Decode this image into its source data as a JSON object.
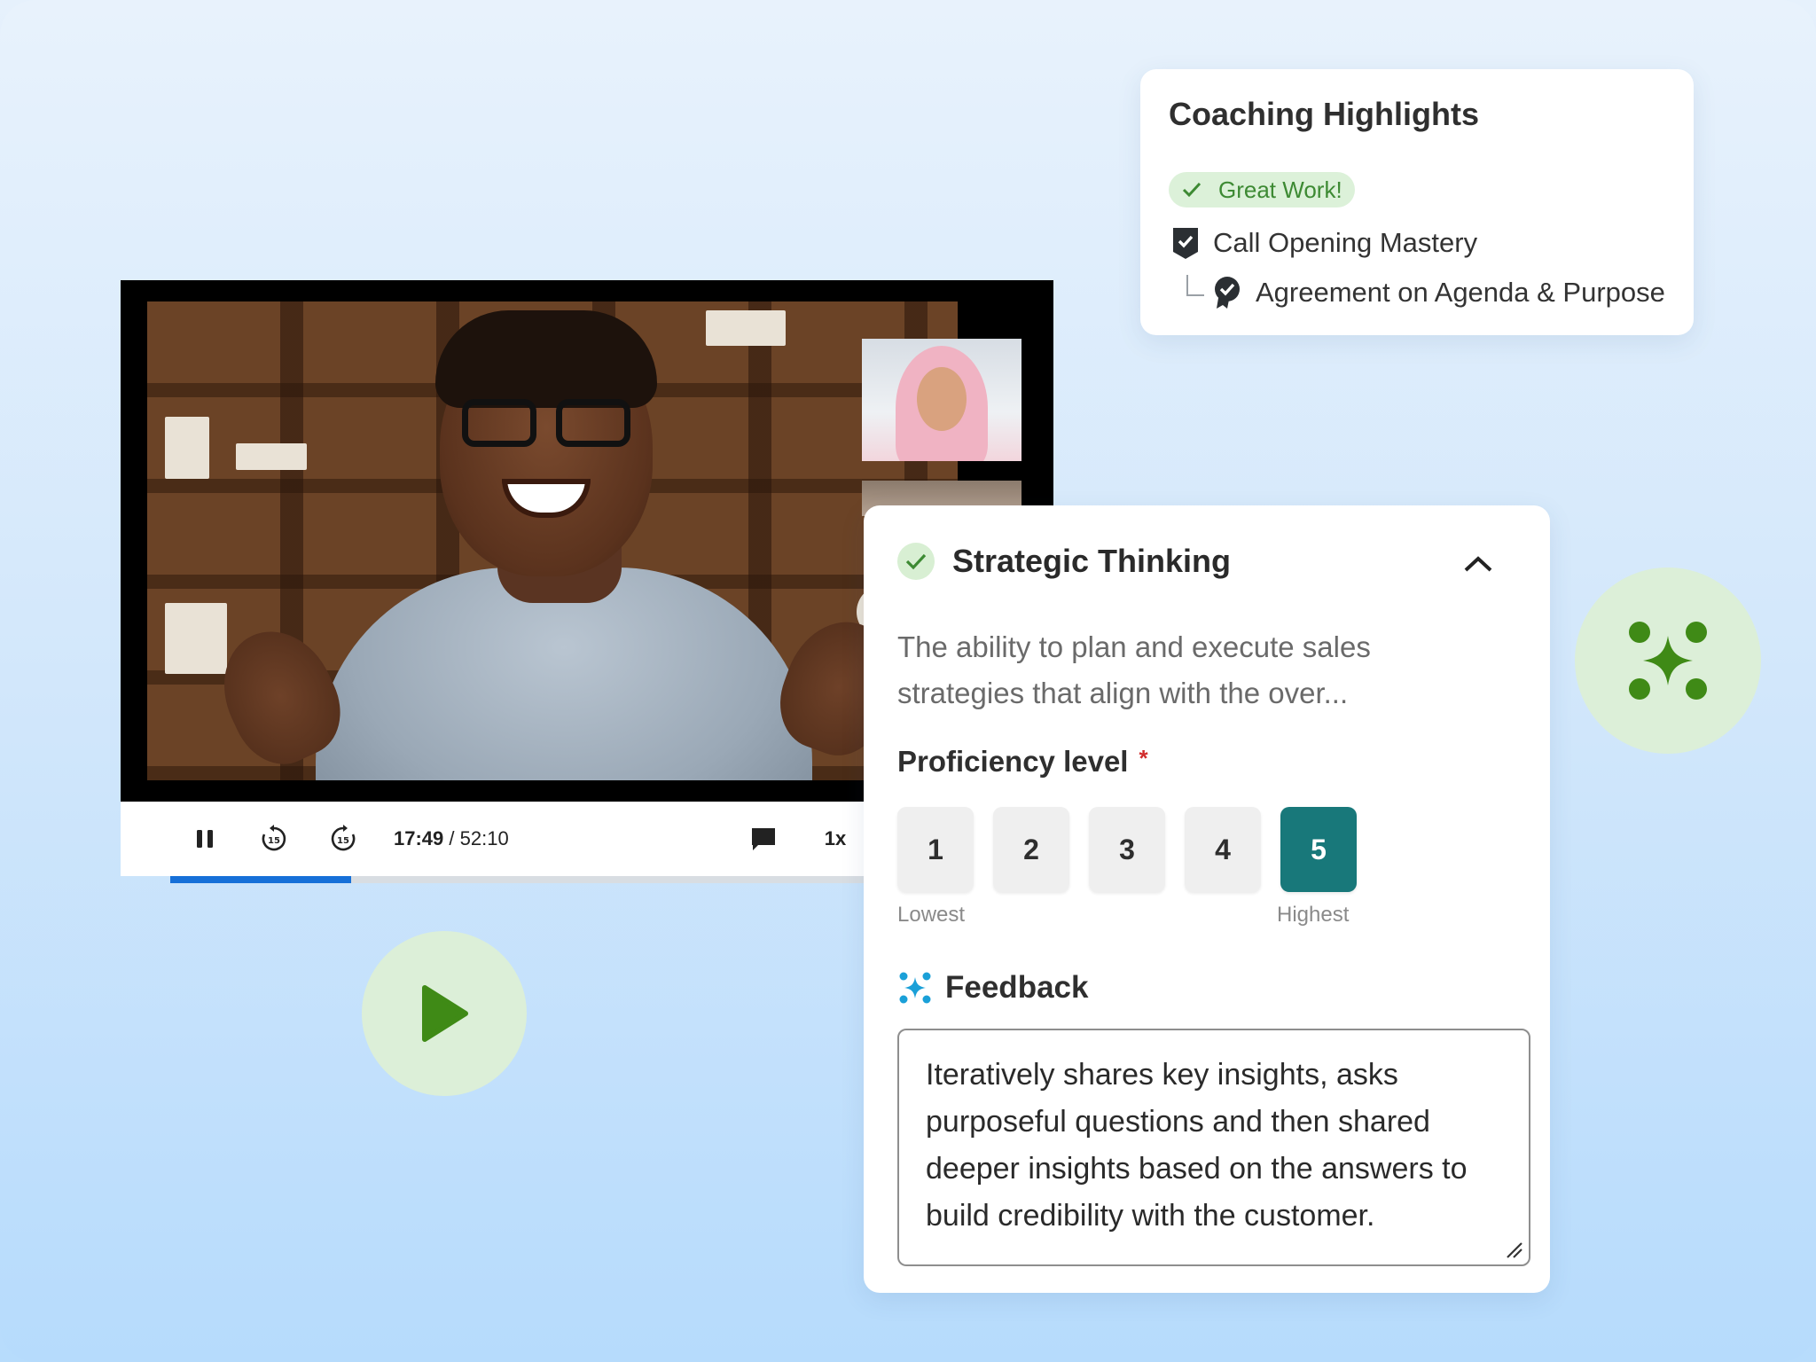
{
  "player": {
    "time_current": "17:49",
    "time_separator": " / ",
    "time_total": "52:10",
    "speed": "1x",
    "progress": 0.205,
    "icons": [
      "pause-icon",
      "rewind-15-icon",
      "forward-15-icon",
      "chat-icon"
    ]
  },
  "highlights": {
    "title": "Coaching Highlights",
    "badge": "Great Work!",
    "item": "Call Opening Mastery",
    "subitem": "Agreement on Agenda & Purpose"
  },
  "panel": {
    "title": "Strategic Thinking",
    "description": "The ability to plan and execute sales strategies that align with the over...",
    "proficiency_label": "Proficiency level",
    "required_mark": "*",
    "levels": [
      "1",
      "2",
      "3",
      "4",
      "5"
    ],
    "selected_level": "5",
    "lowest_label": "Lowest",
    "highest_label": "Highest",
    "feedback_title": "Feedback",
    "feedback_text": "Iteratively shares key insights, asks purposeful questions and then shared deeper insights based on the answers to build credibility with the customer."
  },
  "colors": {
    "accent_teal": "#18787a",
    "progress_blue": "#1670d8",
    "success_green": "#3d8a33",
    "soft_green": "#dcefd8",
    "required_red": "#d12d2d"
  }
}
